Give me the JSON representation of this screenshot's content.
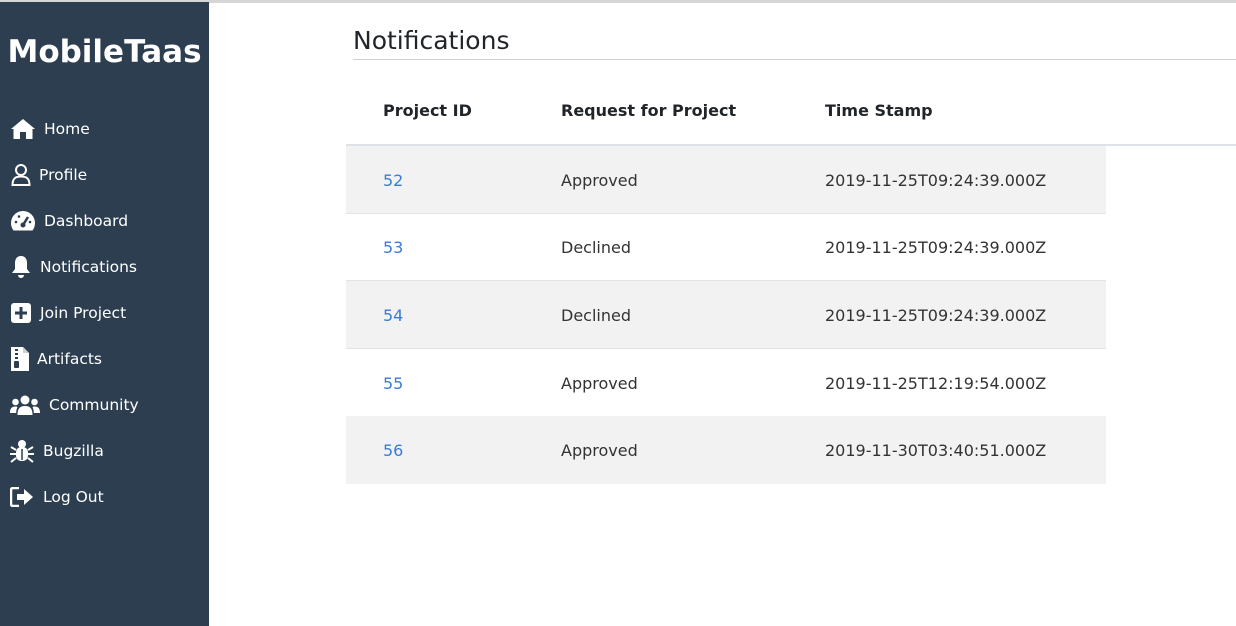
{
  "app": {
    "brand": "MobileTaas"
  },
  "sidebar": {
    "items": [
      {
        "label": "Home",
        "icon": "home-icon"
      },
      {
        "label": "Profile",
        "icon": "user-icon"
      },
      {
        "label": "Dashboard",
        "icon": "dashboard-gauge-icon"
      },
      {
        "label": "Notifications",
        "icon": "bell-icon"
      },
      {
        "label": "Join Project",
        "icon": "plus-square-icon"
      },
      {
        "label": "Artifacts",
        "icon": "file-archive-icon"
      },
      {
        "label": "Community",
        "icon": "users-icon"
      },
      {
        "label": "Bugzilla",
        "icon": "bug-icon"
      },
      {
        "label": "Log Out",
        "icon": "sign-out-icon"
      }
    ]
  },
  "main": {
    "title": "Notifications",
    "table": {
      "headers": [
        "Project ID",
        "Request for Project",
        "Time Stamp"
      ],
      "rows": [
        {
          "id": "52",
          "request": "Approved",
          "timestamp": "2019-11-25T09:24:39.000Z"
        },
        {
          "id": "53",
          "request": "Declined",
          "timestamp": "2019-11-25T09:24:39.000Z"
        },
        {
          "id": "54",
          "request": "Declined",
          "timestamp": "2019-11-25T09:24:39.000Z"
        },
        {
          "id": "55",
          "request": "Approved",
          "timestamp": "2019-11-25T12:19:54.000Z"
        },
        {
          "id": "56",
          "request": "Approved",
          "timestamp": "2019-11-30T03:40:51.000Z"
        }
      ]
    }
  },
  "colors": {
    "sidebar_bg": "#2c3e50",
    "link": "#3a7bd5",
    "stripe": "#f2f2f2"
  }
}
